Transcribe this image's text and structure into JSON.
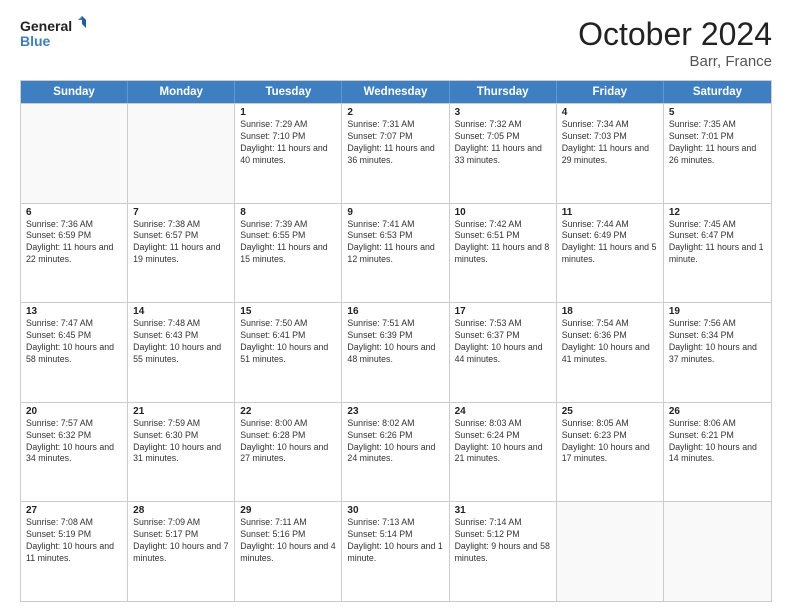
{
  "header": {
    "logo_line1": "General",
    "logo_line2": "Blue",
    "title": "October 2024",
    "subtitle": "Barr, France"
  },
  "weekdays": [
    "Sunday",
    "Monday",
    "Tuesday",
    "Wednesday",
    "Thursday",
    "Friday",
    "Saturday"
  ],
  "weeks": [
    [
      {
        "day": "",
        "sunrise": "",
        "sunset": "",
        "daylight": "",
        "empty": true
      },
      {
        "day": "",
        "sunrise": "",
        "sunset": "",
        "daylight": "",
        "empty": true
      },
      {
        "day": "1",
        "sunrise": "Sunrise: 7:29 AM",
        "sunset": "Sunset: 7:10 PM",
        "daylight": "Daylight: 11 hours and 40 minutes.",
        "empty": false
      },
      {
        "day": "2",
        "sunrise": "Sunrise: 7:31 AM",
        "sunset": "Sunset: 7:07 PM",
        "daylight": "Daylight: 11 hours and 36 minutes.",
        "empty": false
      },
      {
        "day": "3",
        "sunrise": "Sunrise: 7:32 AM",
        "sunset": "Sunset: 7:05 PM",
        "daylight": "Daylight: 11 hours and 33 minutes.",
        "empty": false
      },
      {
        "day": "4",
        "sunrise": "Sunrise: 7:34 AM",
        "sunset": "Sunset: 7:03 PM",
        "daylight": "Daylight: 11 hours and 29 minutes.",
        "empty": false
      },
      {
        "day": "5",
        "sunrise": "Sunrise: 7:35 AM",
        "sunset": "Sunset: 7:01 PM",
        "daylight": "Daylight: 11 hours and 26 minutes.",
        "empty": false
      }
    ],
    [
      {
        "day": "6",
        "sunrise": "Sunrise: 7:36 AM",
        "sunset": "Sunset: 6:59 PM",
        "daylight": "Daylight: 11 hours and 22 minutes.",
        "empty": false
      },
      {
        "day": "7",
        "sunrise": "Sunrise: 7:38 AM",
        "sunset": "Sunset: 6:57 PM",
        "daylight": "Daylight: 11 hours and 19 minutes.",
        "empty": false
      },
      {
        "day": "8",
        "sunrise": "Sunrise: 7:39 AM",
        "sunset": "Sunset: 6:55 PM",
        "daylight": "Daylight: 11 hours and 15 minutes.",
        "empty": false
      },
      {
        "day": "9",
        "sunrise": "Sunrise: 7:41 AM",
        "sunset": "Sunset: 6:53 PM",
        "daylight": "Daylight: 11 hours and 12 minutes.",
        "empty": false
      },
      {
        "day": "10",
        "sunrise": "Sunrise: 7:42 AM",
        "sunset": "Sunset: 6:51 PM",
        "daylight": "Daylight: 11 hours and 8 minutes.",
        "empty": false
      },
      {
        "day": "11",
        "sunrise": "Sunrise: 7:44 AM",
        "sunset": "Sunset: 6:49 PM",
        "daylight": "Daylight: 11 hours and 5 minutes.",
        "empty": false
      },
      {
        "day": "12",
        "sunrise": "Sunrise: 7:45 AM",
        "sunset": "Sunset: 6:47 PM",
        "daylight": "Daylight: 11 hours and 1 minute.",
        "empty": false
      }
    ],
    [
      {
        "day": "13",
        "sunrise": "Sunrise: 7:47 AM",
        "sunset": "Sunset: 6:45 PM",
        "daylight": "Daylight: 10 hours and 58 minutes.",
        "empty": false
      },
      {
        "day": "14",
        "sunrise": "Sunrise: 7:48 AM",
        "sunset": "Sunset: 6:43 PM",
        "daylight": "Daylight: 10 hours and 55 minutes.",
        "empty": false
      },
      {
        "day": "15",
        "sunrise": "Sunrise: 7:50 AM",
        "sunset": "Sunset: 6:41 PM",
        "daylight": "Daylight: 10 hours and 51 minutes.",
        "empty": false
      },
      {
        "day": "16",
        "sunrise": "Sunrise: 7:51 AM",
        "sunset": "Sunset: 6:39 PM",
        "daylight": "Daylight: 10 hours and 48 minutes.",
        "empty": false
      },
      {
        "day": "17",
        "sunrise": "Sunrise: 7:53 AM",
        "sunset": "Sunset: 6:37 PM",
        "daylight": "Daylight: 10 hours and 44 minutes.",
        "empty": false
      },
      {
        "day": "18",
        "sunrise": "Sunrise: 7:54 AM",
        "sunset": "Sunset: 6:36 PM",
        "daylight": "Daylight: 10 hours and 41 minutes.",
        "empty": false
      },
      {
        "day": "19",
        "sunrise": "Sunrise: 7:56 AM",
        "sunset": "Sunset: 6:34 PM",
        "daylight": "Daylight: 10 hours and 37 minutes.",
        "empty": false
      }
    ],
    [
      {
        "day": "20",
        "sunrise": "Sunrise: 7:57 AM",
        "sunset": "Sunset: 6:32 PM",
        "daylight": "Daylight: 10 hours and 34 minutes.",
        "empty": false
      },
      {
        "day": "21",
        "sunrise": "Sunrise: 7:59 AM",
        "sunset": "Sunset: 6:30 PM",
        "daylight": "Daylight: 10 hours and 31 minutes.",
        "empty": false
      },
      {
        "day": "22",
        "sunrise": "Sunrise: 8:00 AM",
        "sunset": "Sunset: 6:28 PM",
        "daylight": "Daylight: 10 hours and 27 minutes.",
        "empty": false
      },
      {
        "day": "23",
        "sunrise": "Sunrise: 8:02 AM",
        "sunset": "Sunset: 6:26 PM",
        "daylight": "Daylight: 10 hours and 24 minutes.",
        "empty": false
      },
      {
        "day": "24",
        "sunrise": "Sunrise: 8:03 AM",
        "sunset": "Sunset: 6:24 PM",
        "daylight": "Daylight: 10 hours and 21 minutes.",
        "empty": false
      },
      {
        "day": "25",
        "sunrise": "Sunrise: 8:05 AM",
        "sunset": "Sunset: 6:23 PM",
        "daylight": "Daylight: 10 hours and 17 minutes.",
        "empty": false
      },
      {
        "day": "26",
        "sunrise": "Sunrise: 8:06 AM",
        "sunset": "Sunset: 6:21 PM",
        "daylight": "Daylight: 10 hours and 14 minutes.",
        "empty": false
      }
    ],
    [
      {
        "day": "27",
        "sunrise": "Sunrise: 7:08 AM",
        "sunset": "Sunset: 5:19 PM",
        "daylight": "Daylight: 10 hours and 11 minutes.",
        "empty": false
      },
      {
        "day": "28",
        "sunrise": "Sunrise: 7:09 AM",
        "sunset": "Sunset: 5:17 PM",
        "daylight": "Daylight: 10 hours and 7 minutes.",
        "empty": false
      },
      {
        "day": "29",
        "sunrise": "Sunrise: 7:11 AM",
        "sunset": "Sunset: 5:16 PM",
        "daylight": "Daylight: 10 hours and 4 minutes.",
        "empty": false
      },
      {
        "day": "30",
        "sunrise": "Sunrise: 7:13 AM",
        "sunset": "Sunset: 5:14 PM",
        "daylight": "Daylight: 10 hours and 1 minute.",
        "empty": false
      },
      {
        "day": "31",
        "sunrise": "Sunrise: 7:14 AM",
        "sunset": "Sunset: 5:12 PM",
        "daylight": "Daylight: 9 hours and 58 minutes.",
        "empty": false
      },
      {
        "day": "",
        "sunrise": "",
        "sunset": "",
        "daylight": "",
        "empty": true
      },
      {
        "day": "",
        "sunrise": "",
        "sunset": "",
        "daylight": "",
        "empty": true
      }
    ]
  ]
}
